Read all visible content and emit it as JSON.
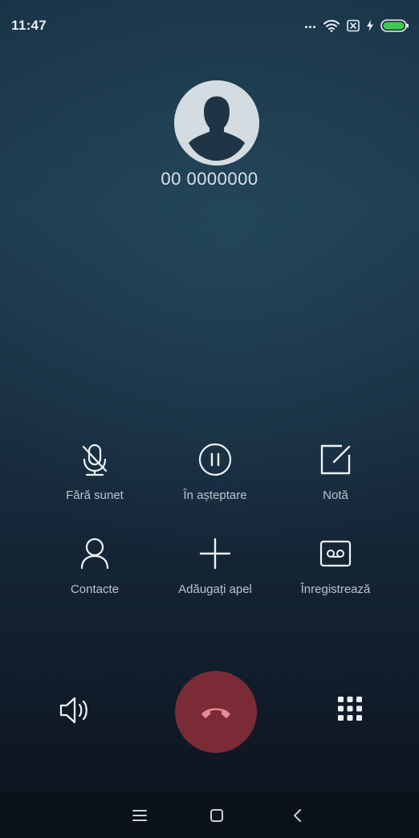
{
  "status_bar": {
    "time": "11:47",
    "signal_dots": "...",
    "icons": [
      "wifi-icon",
      "sim-card-icon",
      "charging-icon",
      "battery-icon"
    ],
    "battery_color": "#3ec94a"
  },
  "caller": {
    "avatar_icon": "person-silhouette-icon",
    "number": "00 0000000"
  },
  "actions": [
    {
      "id": "mute",
      "icon": "mic-off-icon",
      "label": "Fără sunet"
    },
    {
      "id": "hold",
      "icon": "pause-icon",
      "label": "În așteptare"
    },
    {
      "id": "note",
      "icon": "note-edit-icon",
      "label": "Notă"
    },
    {
      "id": "contacts",
      "icon": "person-icon",
      "label": "Contacte"
    },
    {
      "id": "add_call",
      "icon": "plus-icon",
      "label": "Adăugați apel"
    },
    {
      "id": "record",
      "icon": "voicemail-record-icon",
      "label": "Înregistrează"
    }
  ],
  "call_controls": {
    "speaker_icon": "speaker-icon",
    "end_call_icon": "phone-hangup-icon",
    "end_call_color": "#7a2b36",
    "keypad_icon": "dialpad-icon"
  },
  "nav_bar": {
    "items": [
      "menu-icon",
      "home-icon",
      "back-icon"
    ]
  }
}
